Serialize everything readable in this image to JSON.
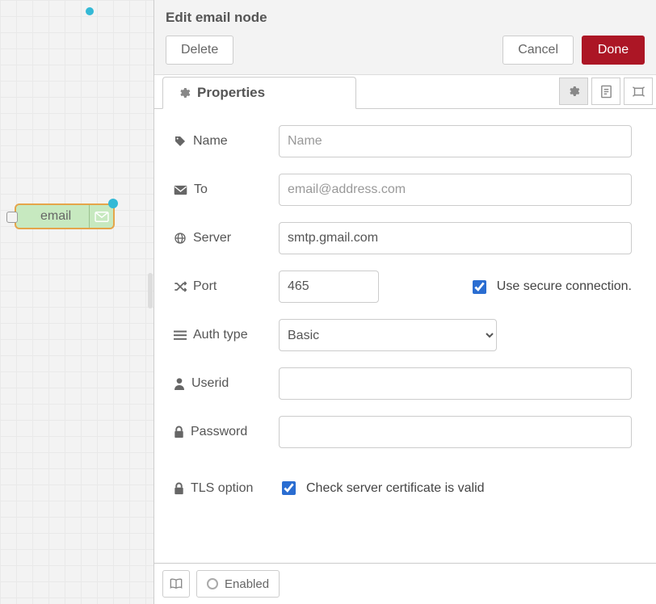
{
  "canvas": {
    "node_label": "email"
  },
  "panel": {
    "title": "Edit email node",
    "actions": {
      "delete": "Delete",
      "cancel": "Cancel",
      "done": "Done"
    },
    "tabs": {
      "properties": "Properties"
    }
  },
  "form": {
    "name": {
      "label": "Name",
      "placeholder": "Name",
      "value": ""
    },
    "to": {
      "label": "To",
      "placeholder": "email@address.com",
      "value": ""
    },
    "server": {
      "label": "Server",
      "value": "smtp.gmail.com"
    },
    "port": {
      "label": "Port",
      "value": "465"
    },
    "secure": {
      "label": "Use secure connection.",
      "checked": true
    },
    "authtype": {
      "label": "Auth type",
      "value": "Basic",
      "options": [
        "Basic"
      ]
    },
    "userid": {
      "label": "Userid",
      "value": ""
    },
    "password": {
      "label": "Password",
      "value": ""
    },
    "tls": {
      "label": "TLS option",
      "check_label": "Check server certificate is valid",
      "checked": true
    }
  },
  "footer": {
    "enabled_label": "Enabled"
  }
}
